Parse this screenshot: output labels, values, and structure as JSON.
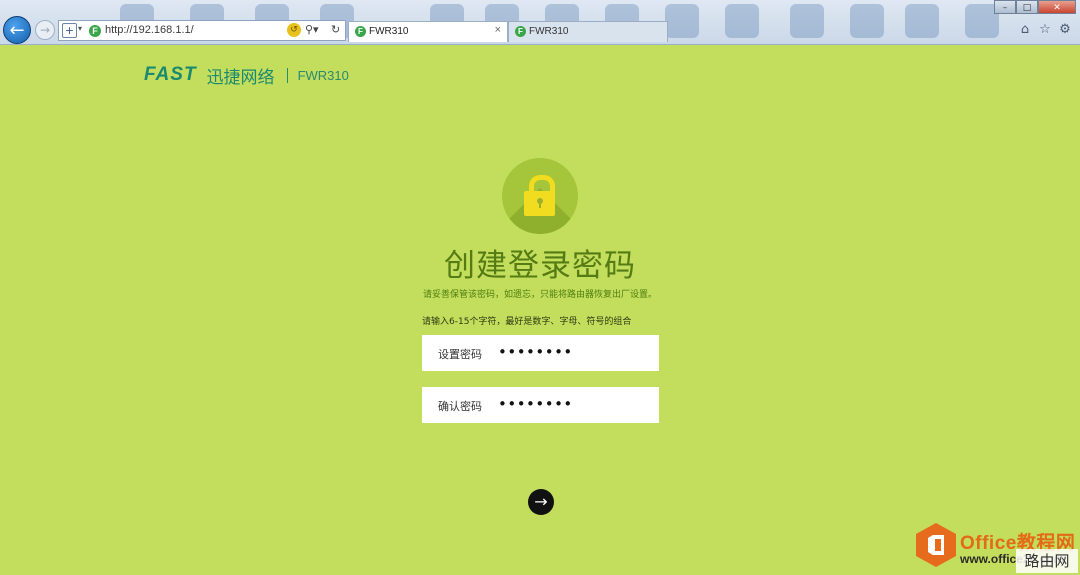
{
  "browser": {
    "url": "http://192.168.1.1/",
    "tabs": [
      {
        "label": "FWR310",
        "active": true
      },
      {
        "label": "FWR310",
        "active": false
      }
    ],
    "favicon_letter": "F",
    "icons": [
      "back-icon",
      "forward-icon",
      "shield-icon",
      "compat-view-icon",
      "search-icon",
      "refresh-icon",
      "close-icon",
      "home-icon",
      "star-icon",
      "gear-icon"
    ]
  },
  "header": {
    "brand": "FAST",
    "brand_cn": "迅捷网络",
    "model": "FWR310"
  },
  "main": {
    "title": "创建登录密码",
    "notice": "请妥善保管该密码，如遗忘，只能将路由器恢复出厂设置。",
    "hint": "请输入6-15个字符，最好是数字、字母、符号的组合",
    "fields": [
      {
        "label": "设置密码",
        "value": "••••••••"
      },
      {
        "label": "确认密码",
        "value": "••••••••"
      }
    ]
  },
  "watermark": {
    "title": "Office教程网",
    "url": "www.office26.com",
    "badge": "路由网"
  },
  "colors": {
    "page_background": "#c3dd5c",
    "title": "#557b14",
    "lock": "#f2dc1f",
    "brand": "#1b8a6f"
  }
}
